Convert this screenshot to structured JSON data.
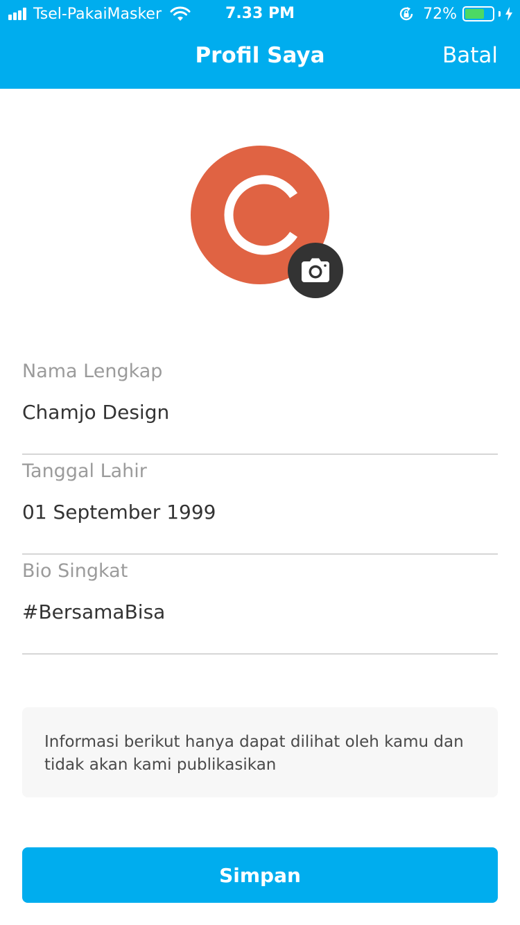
{
  "status_bar": {
    "carrier": "Tsel-PakaiMasker",
    "time": "7.33 PM",
    "battery_percent": "72%",
    "battery_level": 0.72,
    "icons": [
      "signal-icon",
      "wifi-icon",
      "rotation-lock-icon",
      "battery-icon",
      "charging-icon"
    ]
  },
  "header": {
    "title": "Profil Saya",
    "cancel_label": "Batal",
    "background_color": "#00ADEE"
  },
  "avatar": {
    "background_color": "#E06343",
    "icon": "camera-icon"
  },
  "form": {
    "fields": [
      {
        "label": "Nama Lengkap",
        "value": "Chamjo Design"
      },
      {
        "label": "Tanggal Lahir",
        "value": "01 September 1999"
      },
      {
        "label": "Bio Singkat",
        "value": "#BersamaBisa"
      }
    ]
  },
  "info_note": "Informasi berikut hanya dapat dilihat oleh kamu dan tidak akan kami publikasikan",
  "save_button": {
    "label": "Simpan",
    "color": "#00ADEE"
  }
}
